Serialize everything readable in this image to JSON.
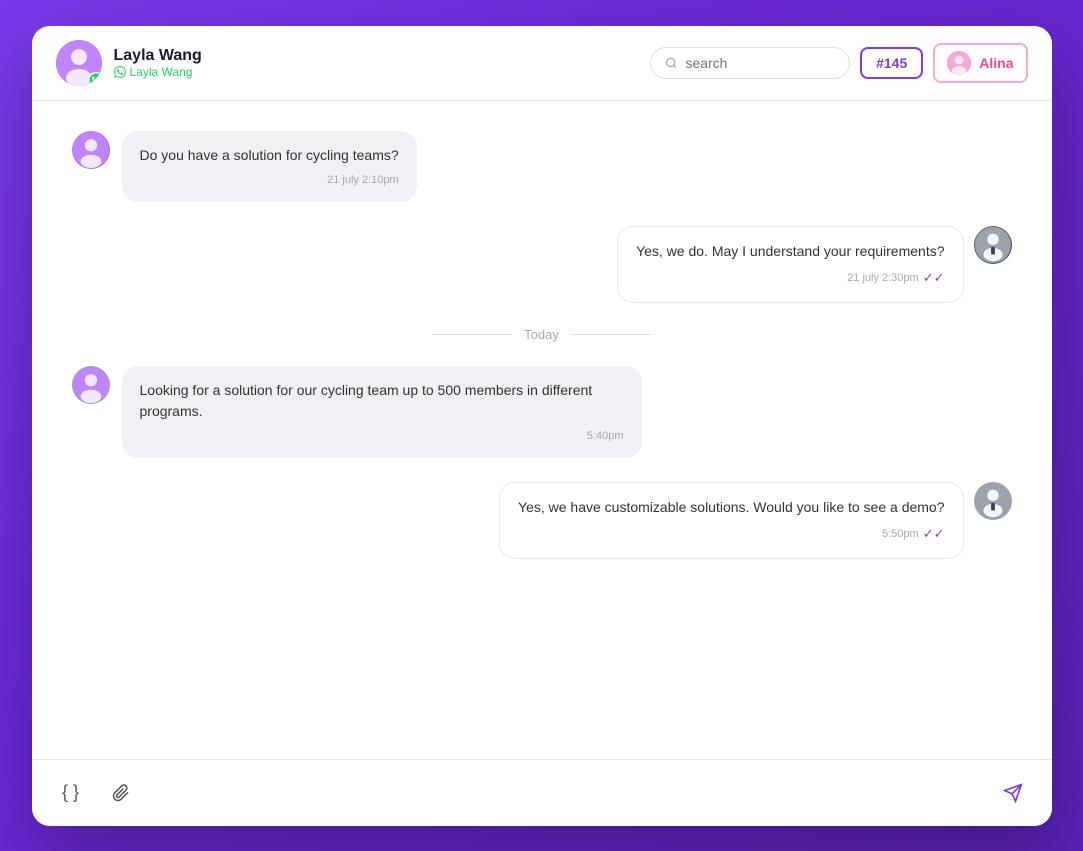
{
  "header": {
    "contact_name": "Layla Wang",
    "contact_platform": "Layla Wang",
    "ticket_number": "#145",
    "agent_name": "Alina",
    "search_placeholder": "search"
  },
  "messages": [
    {
      "id": 1,
      "direction": "incoming",
      "text": "Do you have a solution for cycling teams?",
      "time": "21 july 2:10pm",
      "avatar": "layla"
    },
    {
      "id": 2,
      "direction": "outgoing",
      "text": "Yes, we do. May I understand your requirements?",
      "time": "21 july 2:30pm",
      "checked": true,
      "avatar": "alina"
    },
    {
      "id": 3,
      "type": "divider",
      "label": "Today"
    },
    {
      "id": 4,
      "direction": "incoming",
      "text": "Looking for a solution for our cycling team up to 500 members in different programs.",
      "time": "5:40pm",
      "avatar": "layla"
    },
    {
      "id": 5,
      "direction": "outgoing",
      "text": "Yes, we have customizable solutions. Would you like to see a demo?",
      "time": "5:50pm",
      "checked": true,
      "avatar": "alina"
    }
  ],
  "footer": {
    "placeholder": "",
    "code_btn": "{ }",
    "attach_icon": "paperclip",
    "send_icon": "send"
  }
}
